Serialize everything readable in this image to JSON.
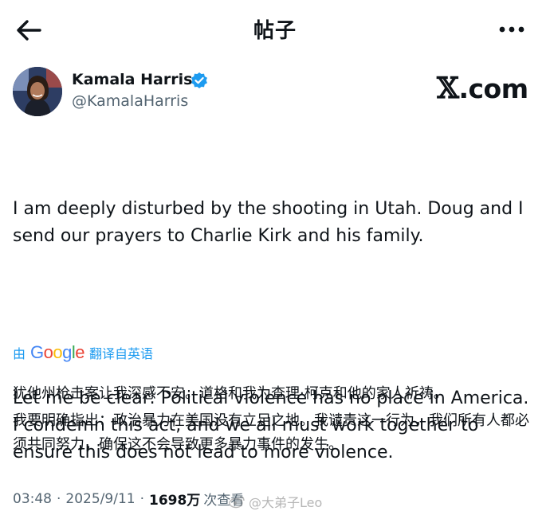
{
  "header": {
    "title": "帖子",
    "back_icon": "arrow-left-icon",
    "more_icon": "more-horizontal-icon"
  },
  "author": {
    "name": "Kamala Harris",
    "handle": "@KamalaHarris",
    "verified_color": "#1d9bf0"
  },
  "brand": {
    "x": "𝕏",
    "suffix": ".com"
  },
  "tweet": {
    "paragraphs": [
      "I am deeply disturbed by the shooting in Utah. Doug and I\nsend our prayers to Charlie Kirk and his family.",
      "Let me be clear: Political violence has no place in America.\nI condemn this act, and we all must work together to\nensure this does not lead to more violence."
    ]
  },
  "translation": {
    "by": "由",
    "provider": "Google",
    "label": "翻译自英语",
    "lines": [
      "犹他州枪击案让我深感不安。道格和我为查理·柯克和他的家人祈祷。",
      "我要明确指出：政治暴力在美国没有立足之地。我谴责这一行为，我们所有人都必须共同努力，确保这不会导致更多暴力事件的发生。"
    ]
  },
  "meta": {
    "time": "03:48",
    "date": "2025/9/11",
    "views": "1698万",
    "views_label": "次查看"
  },
  "watermark": {
    "text": "@大弟子Leo"
  }
}
